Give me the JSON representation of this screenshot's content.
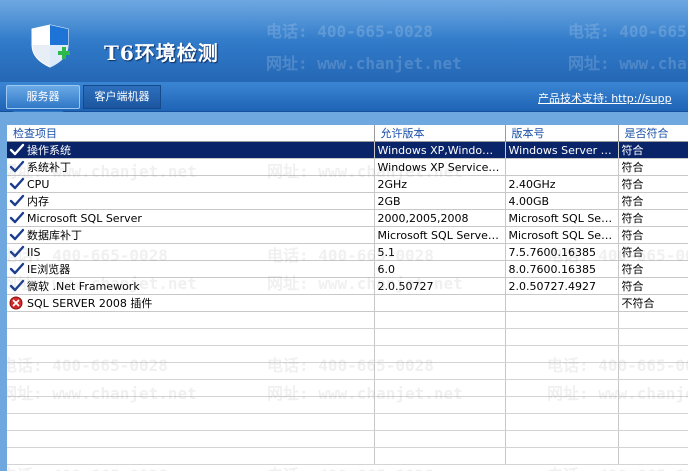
{
  "window": {
    "title": "T6环境检测"
  },
  "watermark": {
    "phone": "电话: 400-665-0028",
    "website": "网址: www.chanjet.net"
  },
  "tabs": [
    {
      "label": "服务器",
      "active": true
    },
    {
      "label": "客户端机器",
      "active": false
    }
  ],
  "support_link": "产品技术支持: http://supp",
  "table": {
    "columns": [
      "检查项目",
      "允许版本",
      "版本号",
      "是否符合"
    ],
    "rows": [
      {
        "status": "pass",
        "item": "操作系统",
        "allowed": "Windows XP,Windows ...",
        "version": "Windows Server 2...",
        "result": "符合",
        "selected": true
      },
      {
        "status": "pass",
        "item": "系统补丁",
        "allowed": "Windows XP Service P...",
        "version": "",
        "result": "符合"
      },
      {
        "status": "pass",
        "item": "CPU",
        "allowed": "2GHz",
        "version": "2.40GHz",
        "result": "符合"
      },
      {
        "status": "pass",
        "item": "内存",
        "allowed": "2GB",
        "version": "4.00GB",
        "result": "符合"
      },
      {
        "status": "pass",
        "item": "Microsoft SQL Server",
        "allowed": "2000,2005,2008",
        "version": "Microsoft SQL Serv...",
        "result": "符合"
      },
      {
        "status": "pass",
        "item": "数据库补丁",
        "allowed": "Microsoft SQL Server 2...",
        "version": "Microsoft SQL Serv...",
        "result": "符合"
      },
      {
        "status": "pass",
        "item": "IIS",
        "allowed": "5.1",
        "version": "7.5.7600.16385",
        "result": "符合"
      },
      {
        "status": "pass",
        "item": "IE浏览器",
        "allowed": "6.0",
        "version": "8.0.7600.16385",
        "result": "符合"
      },
      {
        "status": "pass",
        "item": "微软 .Net Framework",
        "allowed": "2.0.50727",
        "version": "2.0.50727.4927",
        "result": "符合"
      },
      {
        "status": "fail",
        "item": "SQL SERVER 2008 插件",
        "allowed": "",
        "version": "",
        "result": "不符合"
      }
    ]
  },
  "colors": {
    "header": "#2f79c8",
    "selection": "#0a246a",
    "header_text": "#1a50a8",
    "error": "#d42a2a"
  }
}
